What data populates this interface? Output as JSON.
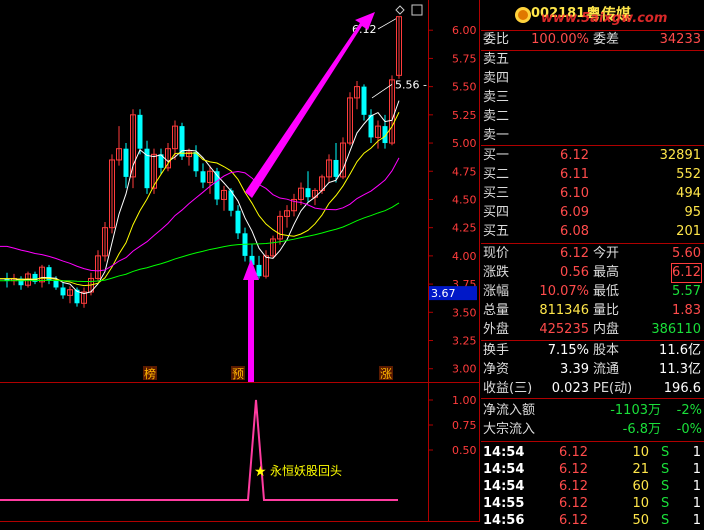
{
  "stock": {
    "code": "002181",
    "name": "粤传媒",
    "watermark": "www.5aixgw.com"
  },
  "ratio": {
    "l1": "委比",
    "v1": "100.00%",
    "l2": "委差",
    "v2": "34233"
  },
  "asks": [
    {
      "label": "卖五"
    },
    {
      "label": "卖四"
    },
    {
      "label": "卖三"
    },
    {
      "label": "卖二"
    },
    {
      "label": "卖一"
    }
  ],
  "bids": [
    {
      "label": "买一",
      "price": "6.12",
      "vol": "32891"
    },
    {
      "label": "买二",
      "price": "6.11",
      "vol": "552"
    },
    {
      "label": "买三",
      "price": "6.10",
      "vol": "494"
    },
    {
      "label": "买四",
      "price": "6.09",
      "vol": "95"
    },
    {
      "label": "买五",
      "price": "6.08",
      "vol": "201"
    }
  ],
  "quote": [
    {
      "l1": "现价",
      "v1": "6.12",
      "l2": "今开",
      "v2": "5.60"
    },
    {
      "l1": "涨跌",
      "v1": "0.56",
      "l2": "最高",
      "v2": "6.12"
    },
    {
      "l1": "涨幅",
      "v1": "10.07%",
      "l2": "最低",
      "v2": "5.57"
    },
    {
      "l1": "总量",
      "v1": "811346",
      "l2": "量比",
      "v2": "1.83"
    },
    {
      "l1": "外盘",
      "v1": "425235",
      "l2": "内盘",
      "v2": "386110"
    }
  ],
  "fund": [
    {
      "l1": "换手",
      "v1": "7.15%",
      "l2": "股本",
      "v2": "11.6亿"
    },
    {
      "l1": "净资",
      "v1": "3.39",
      "l2": "流通",
      "v2": "11.3亿"
    },
    {
      "l1": "收益(三)",
      "v1": "0.023",
      "l2": "PE(动)",
      "v2": "196.6"
    }
  ],
  "flow": [
    {
      "label": "净流入额",
      "amount": "-1103万",
      "pct": "-2%"
    },
    {
      "label": "大宗流入",
      "amount": "-6.8万",
      "pct": "-0%"
    }
  ],
  "ticks": [
    {
      "time": "14:54",
      "price": "6.12",
      "vol": "10",
      "side": "S",
      "n": "1"
    },
    {
      "time": "14:54",
      "price": "6.12",
      "vol": "21",
      "side": "S",
      "n": "1"
    },
    {
      "time": "14:54",
      "price": "6.12",
      "vol": "60",
      "side": "S",
      "n": "1"
    },
    {
      "time": "14:55",
      "price": "6.12",
      "vol": "10",
      "side": "S",
      "n": "1"
    },
    {
      "time": "14:56",
      "price": "6.12",
      "vol": "50",
      "side": "S",
      "n": "1"
    }
  ],
  "axis": {
    "price_ticks": [
      "6.00",
      "5.75",
      "5.50",
      "5.25",
      "5.00",
      "4.75",
      "4.50",
      "4.25",
      "4.00",
      "3.75",
      "3.50",
      "3.25",
      "3.00"
    ],
    "ind_ticks": [
      "1.00",
      "0.75",
      "0.50"
    ],
    "current_price_tag": "3.67",
    "high_label": "6.12",
    "mark_label": "5.56"
  },
  "markers": [
    "榜",
    "预",
    "涨"
  ],
  "indicator_label": "永恒妖股回头",
  "colors": {
    "up": "#ff3c3c",
    "down": "#00ffff",
    "ma5": "#ffffff",
    "ma10": "#ffff00",
    "ma20": "#ff00ff",
    "ma60": "#00ff00",
    "arrow": "#ff00ff",
    "signal": "#ff3ca0",
    "axis": "#b00000"
  },
  "chart_data": {
    "type": "candlestick",
    "ylim": [
      2.9,
      6.25
    ],
    "candles": [
      [
        3.8,
        3.85,
        3.72,
        3.78
      ],
      [
        3.78,
        3.84,
        3.74,
        3.8
      ],
      [
        3.8,
        3.82,
        3.7,
        3.74
      ],
      [
        3.74,
        3.86,
        3.72,
        3.84
      ],
      [
        3.84,
        3.86,
        3.75,
        3.77
      ],
      [
        3.77,
        3.92,
        3.72,
        3.9
      ],
      [
        3.9,
        3.92,
        3.75,
        3.78
      ],
      [
        3.78,
        3.82,
        3.7,
        3.72
      ],
      [
        3.72,
        3.76,
        3.62,
        3.65
      ],
      [
        3.65,
        3.73,
        3.58,
        3.7
      ],
      [
        3.7,
        3.72,
        3.55,
        3.58
      ],
      [
        3.58,
        3.72,
        3.54,
        3.68
      ],
      [
        3.68,
        3.85,
        3.65,
        3.8
      ],
      [
        3.8,
        4.05,
        3.78,
        4.0
      ],
      [
        4.0,
        4.3,
        3.95,
        4.25
      ],
      [
        4.25,
        4.9,
        4.2,
        4.85
      ],
      [
        4.85,
        5.15,
        4.8,
        4.95
      ],
      [
        4.95,
        5.0,
        4.6,
        4.7
      ],
      [
        4.7,
        5.3,
        4.6,
        5.25
      ],
      [
        5.25,
        5.3,
        4.9,
        4.95
      ],
      [
        4.95,
        5.02,
        4.55,
        4.6
      ],
      [
        4.6,
        4.95,
        4.55,
        4.9
      ],
      [
        4.9,
        4.95,
        4.72,
        4.78
      ],
      [
        4.78,
        5.0,
        4.75,
        4.95
      ],
      [
        4.95,
        5.2,
        4.85,
        5.15
      ],
      [
        5.15,
        5.18,
        4.85,
        4.88
      ],
      [
        4.88,
        4.95,
        4.8,
        4.92
      ],
      [
        4.92,
        4.98,
        4.7,
        4.75
      ],
      [
        4.75,
        4.82,
        4.6,
        4.65
      ],
      [
        4.65,
        4.8,
        4.55,
        4.75
      ],
      [
        4.75,
        4.78,
        4.45,
        4.5
      ],
      [
        4.5,
        4.62,
        4.4,
        4.58
      ],
      [
        4.58,
        4.6,
        4.35,
        4.4
      ],
      [
        4.4,
        4.45,
        4.15,
        4.2
      ],
      [
        4.2,
        4.25,
        3.95,
        4.0
      ],
      [
        4.0,
        4.1,
        3.88,
        3.92
      ],
      [
        3.92,
        4.0,
        3.8,
        3.82
      ],
      [
        3.82,
        4.05,
        3.8,
        4.0
      ],
      [
        4.0,
        4.18,
        3.98,
        4.15
      ],
      [
        4.15,
        4.4,
        4.1,
        4.35
      ],
      [
        4.35,
        4.45,
        4.25,
        4.4
      ],
      [
        4.4,
        4.55,
        4.35,
        4.5
      ],
      [
        4.5,
        4.65,
        4.45,
        4.6
      ],
      [
        4.6,
        4.75,
        4.48,
        4.52
      ],
      [
        4.52,
        4.6,
        4.45,
        4.58
      ],
      [
        4.58,
        4.72,
        4.55,
        4.7
      ],
      [
        4.7,
        4.9,
        4.65,
        4.85
      ],
      [
        4.85,
        5.0,
        4.65,
        4.7
      ],
      [
        4.7,
        5.05,
        4.68,
        5.0
      ],
      [
        5.0,
        5.45,
        4.98,
        5.4
      ],
      [
        5.4,
        5.55,
        5.3,
        5.5
      ],
      [
        5.5,
        5.52,
        5.2,
        5.25
      ],
      [
        5.25,
        5.3,
        5.0,
        5.05
      ],
      [
        5.05,
        5.2,
        4.95,
        5.15
      ],
      [
        5.15,
        5.25,
        4.95,
        5.0
      ],
      [
        5.0,
        5.6,
        4.98,
        5.56
      ],
      [
        5.6,
        6.12,
        5.57,
        6.12
      ]
    ]
  }
}
